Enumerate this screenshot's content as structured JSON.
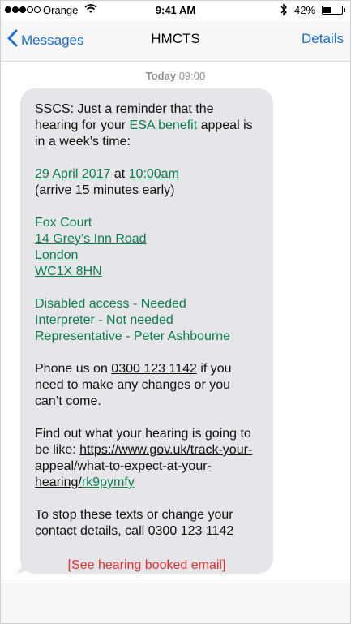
{
  "status_bar": {
    "carrier": "Orange",
    "time": "9:41 AM",
    "battery": "42%",
    "battery_level": 0.42
  },
  "nav": {
    "back_label": "Messages",
    "title": "HMCTS",
    "details_label": "Details"
  },
  "timestamp": {
    "day": "Today",
    "time": "09:00"
  },
  "message": {
    "intro_1": "SSCS: Just a reminder that the hearing for your ",
    "benefit": "ESA benefit",
    "intro_2": " appeal is in a week’s time:",
    "date": "29 April 2017",
    "at": " at ",
    "hearing_time": "10:00am",
    "arrive": "(arrive 15 minutes early)",
    "venue_name": "Fox Court",
    "address_1": "14 Grey’s Inn Road",
    "address_2": "London",
    "postcode": "WC1X 8HN",
    "disabled_access": "Disabled access - Needed",
    "interpreter": "Interpreter - Not needed",
    "representative": "Representative - Peter Ashbourne",
    "phone_1": "Phone us on ",
    "phone_number": "0300 123 1142",
    "phone_2": " if you need to make any changes or you can’t come.",
    "find_out": "Find out what your hearing is going to be like: ",
    "link_url": "https://www.gov.uk/track-your-appeal/what-to-expect-at-your-hearing/",
    "link_code": "rk9pymfy",
    "stop_1": "To stop these texts or change your contact details, call 0",
    "stop_phone": "300 123 1142",
    "note": "[See hearing booked email]"
  },
  "colors": {
    "accent": "#1a6fd6",
    "green": "#0b7f4a",
    "red": "#e03131",
    "bubble": "#e5e5ea"
  },
  "icons": [
    "signal-dots-icon",
    "wifi-icon",
    "bluetooth-icon",
    "battery-icon",
    "back-chevron-icon"
  ]
}
